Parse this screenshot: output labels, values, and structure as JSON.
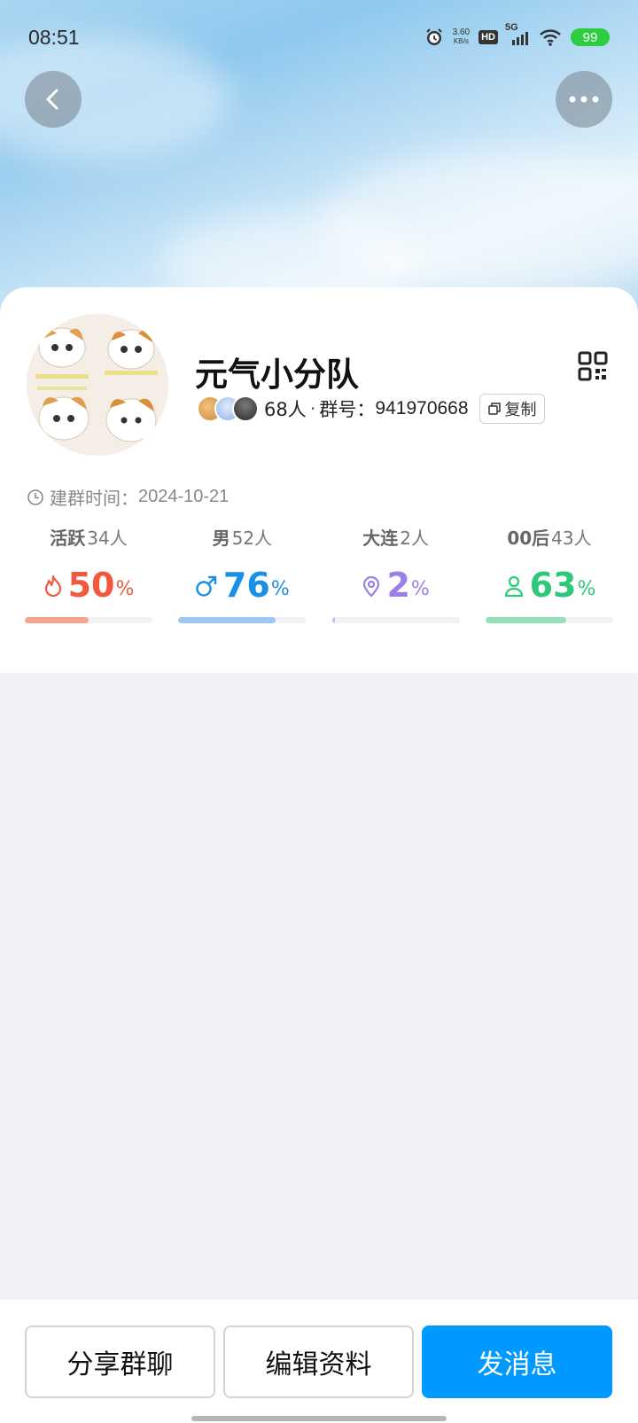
{
  "status_bar": {
    "time": "08:51",
    "net_speed_value": "3.60",
    "net_speed_unit": "KB/s",
    "hd": "HD",
    "network": "5G",
    "battery": "99",
    "battery_color": "#2ecc40"
  },
  "header": {
    "back_icon": "chevron-left-icon",
    "more_icon": "more-dots-icon"
  },
  "group": {
    "name": "元气小分队",
    "member_count": "68人",
    "separator": "·",
    "id_label": "群号：",
    "id_value": "941970668",
    "copy_label": "复制",
    "created_label": "建群时间：",
    "created_date": "2024-10-21"
  },
  "stats": [
    {
      "label": "活跃",
      "count": "34人",
      "value": "50",
      "unit": "%",
      "percent": 50,
      "color": "#f0593e",
      "bar_color": "#f7a394",
      "icon": "flame-icon"
    },
    {
      "label": "男",
      "count": "52人",
      "value": "76",
      "unit": "%",
      "percent": 76,
      "color": "#1a8fe6",
      "bar_color": "#9cc8f5",
      "icon": "male-icon"
    },
    {
      "label": "大连",
      "count": "2人",
      "value": "2",
      "unit": "%",
      "percent": 2,
      "color": "#9b7ee6",
      "bar_color": "#c9b8f2",
      "icon": "location-pin-icon"
    },
    {
      "label": "00后",
      "count": "43人",
      "value": "63",
      "unit": "%",
      "percent": 63,
      "color": "#2cc97a",
      "bar_color": "#95e0b6",
      "icon": "person-icon"
    }
  ],
  "actions": {
    "share": "分享群聊",
    "edit": "编辑资料",
    "message": "发消息",
    "primary_color": "#0099ff"
  }
}
